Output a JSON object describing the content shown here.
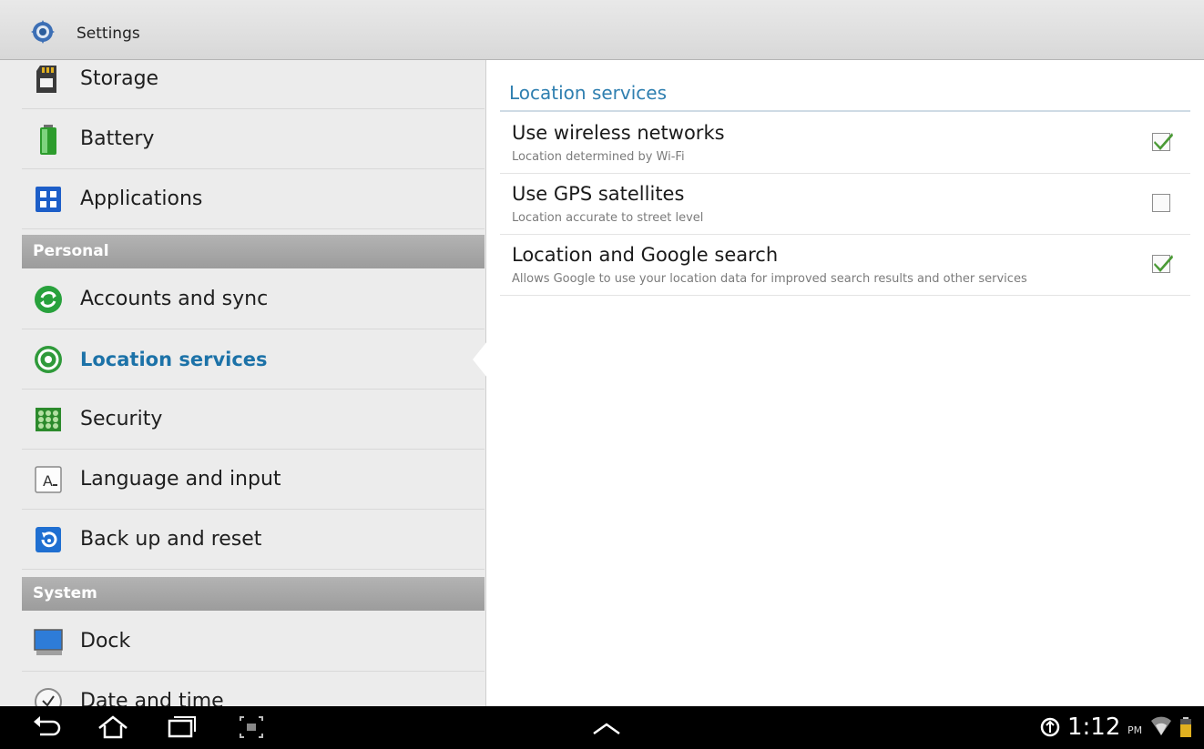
{
  "app": {
    "title": "Settings"
  },
  "sidebar": {
    "items": [
      {
        "label": "Storage",
        "icon": "sd-card-icon"
      },
      {
        "label": "Battery",
        "icon": "battery-icon"
      },
      {
        "label": "Applications",
        "icon": "applications-grid-icon"
      },
      {
        "section": "Personal"
      },
      {
        "label": "Accounts and sync",
        "icon": "sync-icon"
      },
      {
        "label": "Location services",
        "icon": "location-target-icon",
        "selected": true
      },
      {
        "label": "Security",
        "icon": "lock-grid-icon"
      },
      {
        "label": "Language and input",
        "icon": "keyboard-letter-icon"
      },
      {
        "label": "Back up and reset",
        "icon": "backup-reset-icon"
      },
      {
        "section": "System"
      },
      {
        "label": "Dock",
        "icon": "dock-monitor-icon"
      },
      {
        "label": "Date and time",
        "icon": "clock-icon"
      }
    ]
  },
  "main": {
    "section_title": "Location services",
    "preferences": [
      {
        "title": "Use wireless networks",
        "summary": "Location determined by Wi-Fi",
        "checked": true
      },
      {
        "title": "Use GPS satellites",
        "summary": "Location accurate to street level",
        "checked": false
      },
      {
        "title": "Location and Google search",
        "summary": "Allows Google to use your location data for improved search results and other services",
        "checked": true
      }
    ]
  },
  "navbar": {
    "time": "1:12",
    "ampm": "PM",
    "icons": [
      "back-icon",
      "home-icon",
      "recent-apps-icon",
      "screenshot-icon",
      "up-chevron-icon",
      "usb-icon",
      "wifi-icon",
      "battery-status-icon"
    ]
  },
  "colors": {
    "accent": "#1c72a8",
    "section_title": "#2f7fb0",
    "check_green": "#4a9a35",
    "section_header": "#a6a6a6"
  }
}
